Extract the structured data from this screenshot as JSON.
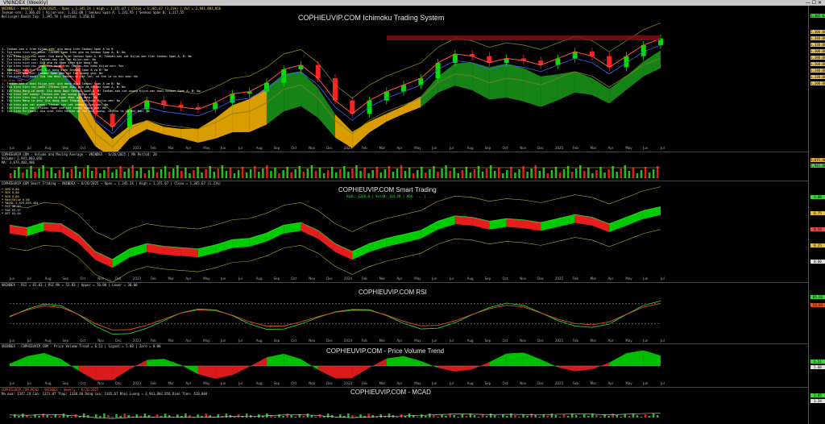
{
  "window": {
    "title": "VNINDEX (Weekly)"
  },
  "panes": {
    "ichimoku": {
      "title": "COPHIEUVIP.COM Ichimoku Trading System",
      "header": "VNINDEX - Weekly - 6/26/2025 - Open = 1,345.24 | High = 1,371.07 | Close = 1,365.67 (1.21%) | Vol = 2,941,803,056",
      "sub1": "Tenkan-sen: 1,366.65 | Kijun-sen: 1,322.08 | Senkou Span A: 1,241.95 | Senkou Span B: 1,217.55",
      "sub2": "Bollinger Bands Top: 1,395.78 | Bottom: 1,250.61"
    },
    "volume": {
      "header": "COPHIEUVIP.COM - Volume and Moving Average - VNINDEX - 6/26/2025 | MA Period: 20",
      "line2": "Volume: 2,941,803,056",
      "line3": "MA: 3,673,402,486"
    },
    "smart": {
      "title": "COPHIEUVIP.COM Smart Trading",
      "header": "COPHIEUVIP.COM Smart Trading - VNINDEX - 6/26/2025 - Open = 1,345.24 | High = 1,371.07 | Close = 1,365.67 (1.21%)",
      "subtitle": "HiUL: 1266.0 | Vol/B: 114,58 | ADX: ... | ...",
      "lines": [
        "* BPD      0.00",
        "* BCK      0.00",
        "* BCB      0.00",
        "* BestValue     0.00",
        "* MAVOL  3,625,859,404",
        "* RSI       58.63",
        "* RSK       63.97",
        "* BFT       83.04"
      ]
    },
    "rsi": {
      "title": "COPHIEUVIP.COM RSI",
      "header": "VNINDEX - RSI = 65.63 | RSI MA = 53.83 | Upper = 70.00 | Lower = 30.00"
    },
    "pvt": {
      "title": "COPHIEUVIP.COM - Price Volume Trend",
      "header": "VNINDEX - COPHIEUVIP.COM - Price Volume Trend = 6.51 | Signal = 5.08 | Zero = 0.00"
    },
    "macd": {
      "title": "COPHIEUVIP.COM - MCAD",
      "header": "COPHIEUVIP.COM MCAD - VNINDEX - Weekly - 6/26/2025",
      "line2": "Ma mua: 1347.24  Can: 1371.07  Thap: 1338.48  Dong cua: 1365.67  Khoi Luong = 2,941,803,056  Dien Tien: 420.004"
    }
  },
  "axis": {
    "price_ticks": [
      "1,360.00",
      "1,340.00",
      "1,320.00",
      "1,300.00",
      "1,280.00",
      "1,260.00",
      "1,240.00",
      "1,220.00",
      "1,200.00"
    ],
    "price_tag": "1,365.67",
    "vol_tags": [
      "3,671.40",
      "2,941.80"
    ],
    "smart_tags": [
      "1.00",
      "0.75",
      "0.50",
      "0.25",
      "0.00"
    ],
    "rsi_tags": [
      "65.63",
      "53.83"
    ],
    "pvt_tags": [
      "6.51",
      "5.08"
    ],
    "macd_tags": [
      "2.05",
      "1.34"
    ]
  },
  "months": [
    "Jun",
    "Jul",
    "Aug",
    "Sep",
    "Oct",
    "Nov",
    "Dec",
    "2023",
    "Feb",
    "Mar",
    "Apr",
    "May",
    "Jun",
    "Jul",
    "Aug",
    "Sep",
    "Oct",
    "Nov",
    "Dec",
    "2024",
    "Feb",
    "Mar",
    "Apr",
    "May",
    "Jun",
    "Jul",
    "Aug",
    "Sep",
    "Oct",
    "Nov",
    "Dec",
    "2025",
    "Feb",
    "Mar",
    "Apr",
    "May",
    "Jun",
    "Jul"
  ],
  "legend": [
    "1. Tenkan-sen o tren Kijun-sen: gia dong tren Senkou Span A va B",
    "2. Tin hieu tich cuc manh: Chikou Span tren gia va Senkou Span A, B: No",
    "3. Tin hieu tich cuc manh: Gia dong tren Senkou Span A, B; Tenkan-sen cat Kijun-sen tren Senkou Span A, B: No",
    "4. Tin hieu tich cuc: Tenkan-sen cat len Kijun-sen: No",
    "5. Tin hieu tich cuc: Gia pha vo ngan tren gia dong: No",
    "6. Tin hieu tich cuc yeu: Gia dong tren Tenkan-sen hoac Kijun-sen: Yes",
    "7. Tin hieu gia tri tot: Gia dong tren Senkou Span A va B: No",
    "8. Tin hieu gia tot: Chikou Span gan cat len duong gia: No",
    "9. Tin hieu Pullback: Gia lam duoi tenkan-sn cat len, co the la co hoi mua: No",
    "Tin hieu Ban",
    "1. Tenkan-sen o duoi Kijun-sen: gia dong duoi Senkou Span A va B: No",
    "2. Tin hieu tieu cuc manh: Chikou Span duoi gia va Senkou Span A, B: No",
    "3. Tin hieu Mang Lo manh: Gia dong duoi Senkou Span A, B; Tenkan-sen cat xuong Kijun-sen duoi Senkou Span A, B: No",
    "4. Tin hieu cat xuong: Tenkan-sen cat xuong Kijun-sen: No",
    "5. Tin hieu tieu cuc: Gia pha vo ngan duoi gia dong: No",
    "6. Tin hieu Mang Lo yeu: Gia dong duoi Tenkan-sen hoac Kijun-sen: No",
    "7. Tin hieu gia cat xuong: Tenkan-sen cat xuong Kijun-sen: No",
    "8. Tin hieu gia xau: Chikou Span gan cat xuong duong gia: No",
    "9. Tin hieu Pullback: Gia vuot tren tenkan-sn roi cat xuong, co the la co hoi ban: No"
  ],
  "colors": {
    "bull": "#00e000",
    "bear": "#ff2020",
    "cloud_up": "#1a9a1a",
    "cloud_dn": "#ffb800"
  },
  "chart_data": {
    "type": "line",
    "title": "COPHIEUVIP.COM Ichimoku Trading System",
    "series": [
      {
        "name": "VNINDEX",
        "values": [
          1220,
          1200,
          1240,
          1230,
          1150,
          1020,
          960,
          1040,
          1080,
          1060,
          1050,
          1040,
          1070,
          1110,
          1120,
          1160,
          1220,
          1240,
          1180,
          1080,
          1020,
          1080,
          1120,
          1150,
          1180,
          1250,
          1290,
          1280,
          1250,
          1270,
          1260,
          1240,
          1270,
          1300,
          1280,
          1230,
          1280,
          1330,
          1360
        ]
      }
    ]
  }
}
